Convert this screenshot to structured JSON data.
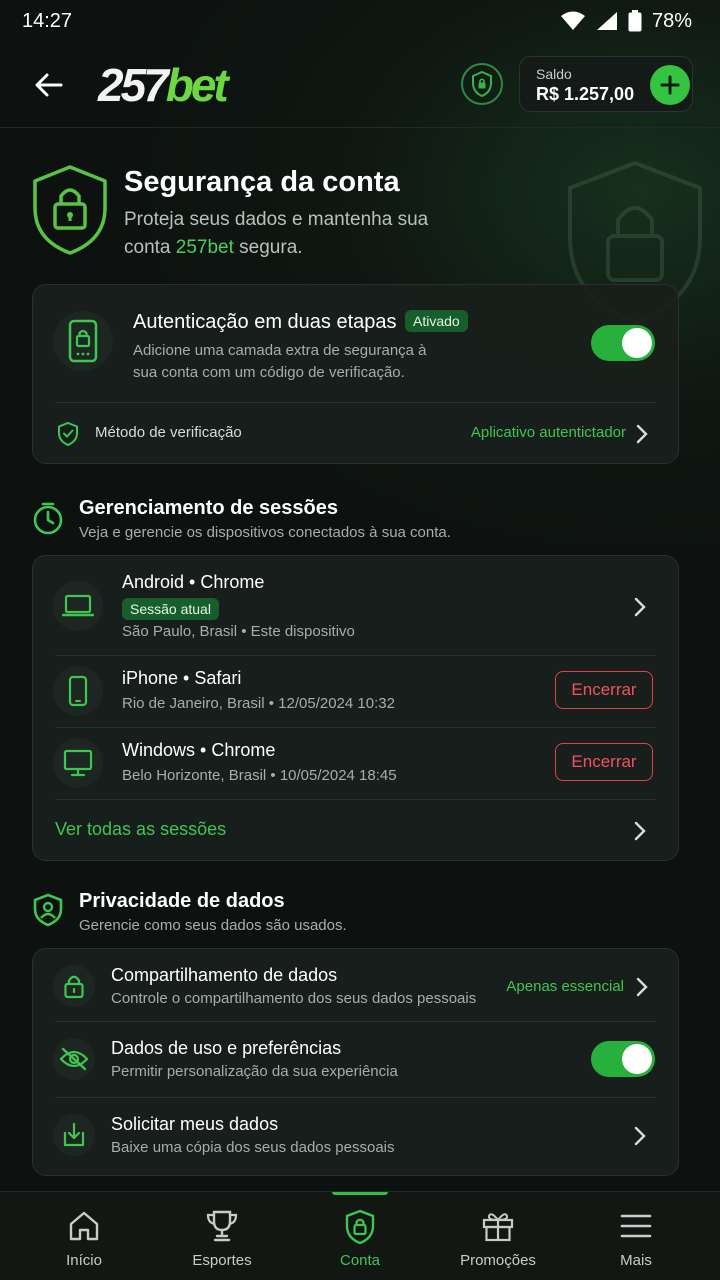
{
  "status_bar": {
    "time": "14:27",
    "battery": "78%"
  },
  "header": {
    "logo_number": "257",
    "logo_text": "bet",
    "balance_label": "Saldo",
    "balance_value": "R$ 1.257,00"
  },
  "hero": {
    "title": "Segurança da conta",
    "subtitle_part1": "Proteja seus dados e mantenha sua conta ",
    "subtitle_brand": "257bet",
    "subtitle_part2": " segura."
  },
  "two_factor": {
    "title": "Autenticação em duas etapas",
    "badge": "Ativado",
    "description": "Adicione uma camada extra de segurança à sua conta com um código de verificação.",
    "enabled": true,
    "method_label": "Método de verificação",
    "method_value": "Aplicativo autentictador"
  },
  "sessions": {
    "title": "Gerenciamento de sessões",
    "subtitle": "Veja e gerencie os dispositivos conectados à sua conta.",
    "items": [
      {
        "device": "Android • Chrome",
        "badge": "Sessão atual",
        "meta": "São Paulo, Brasil • Este dispositivo",
        "icon": "laptop-icon"
      },
      {
        "device": "iPhone • Safari",
        "meta": "Rio de Janeiro, Brasil • 12/05/2024 10:32",
        "action": "Encerrar",
        "icon": "phone-icon"
      },
      {
        "device": "Windows • Chrome",
        "meta": "Belo Horizonte, Brasil • 10/05/2024 18:45",
        "action": "Encerrar",
        "icon": "monitor-icon"
      }
    ],
    "view_all": "Ver todas as sessões"
  },
  "privacy": {
    "title": "Privacidade de dados",
    "subtitle": "Gerencie como seus dados são usados.",
    "items": [
      {
        "title": "Compartilhamento de dados",
        "subtitle": "Controle o compartilhamento dos seus dados pessoais",
        "value": "Apenas essencial",
        "icon": "lock-icon"
      },
      {
        "title": "Dados de uso e preferências",
        "subtitle": "Permitir personalização da sua experiência",
        "enabled": true,
        "icon": "eye-off-icon"
      },
      {
        "title": "Solicitar meus dados",
        "subtitle": "Baixe uma cópia dos seus dados pessoais",
        "icon": "download-icon"
      }
    ]
  },
  "nav": {
    "items": [
      {
        "label": "Início",
        "icon": "home-icon"
      },
      {
        "label": "Esportes",
        "icon": "trophy-icon"
      },
      {
        "label": "Conta",
        "icon": "shield-lock-icon",
        "active": true
      },
      {
        "label": "Promoções",
        "icon": "gift-icon"
      },
      {
        "label": "Mais",
        "icon": "menu-icon"
      }
    ]
  },
  "colors": {
    "accent": "#3fc551",
    "danger": "#f0525e",
    "background": "#0d1210",
    "card": "#191f1c"
  }
}
